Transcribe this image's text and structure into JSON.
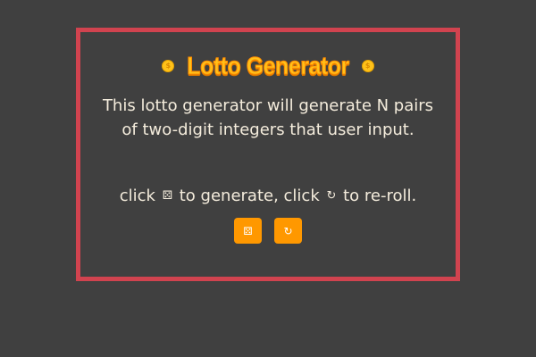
{
  "header": {
    "title": "Lotto Generator",
    "coin_icon_left": "coin-icon",
    "coin_icon_right": "coin-icon",
    "coin_glyph": "$"
  },
  "description": "This lotto generator will generate N pairs of two-digit integers that user input.",
  "instruction": {
    "part1": "click",
    "dice_icon": "⚄",
    "part2": "to generate, click",
    "reroll_icon": "↻",
    "part3": "to re-roll."
  },
  "buttons": {
    "generate_icon": "⚄",
    "reroll_icon": "↻"
  },
  "colors": {
    "background": "#404040",
    "border": "#d1434f",
    "title": "#ffc21a",
    "button": "#ff9800",
    "text": "#f4ecdc"
  }
}
